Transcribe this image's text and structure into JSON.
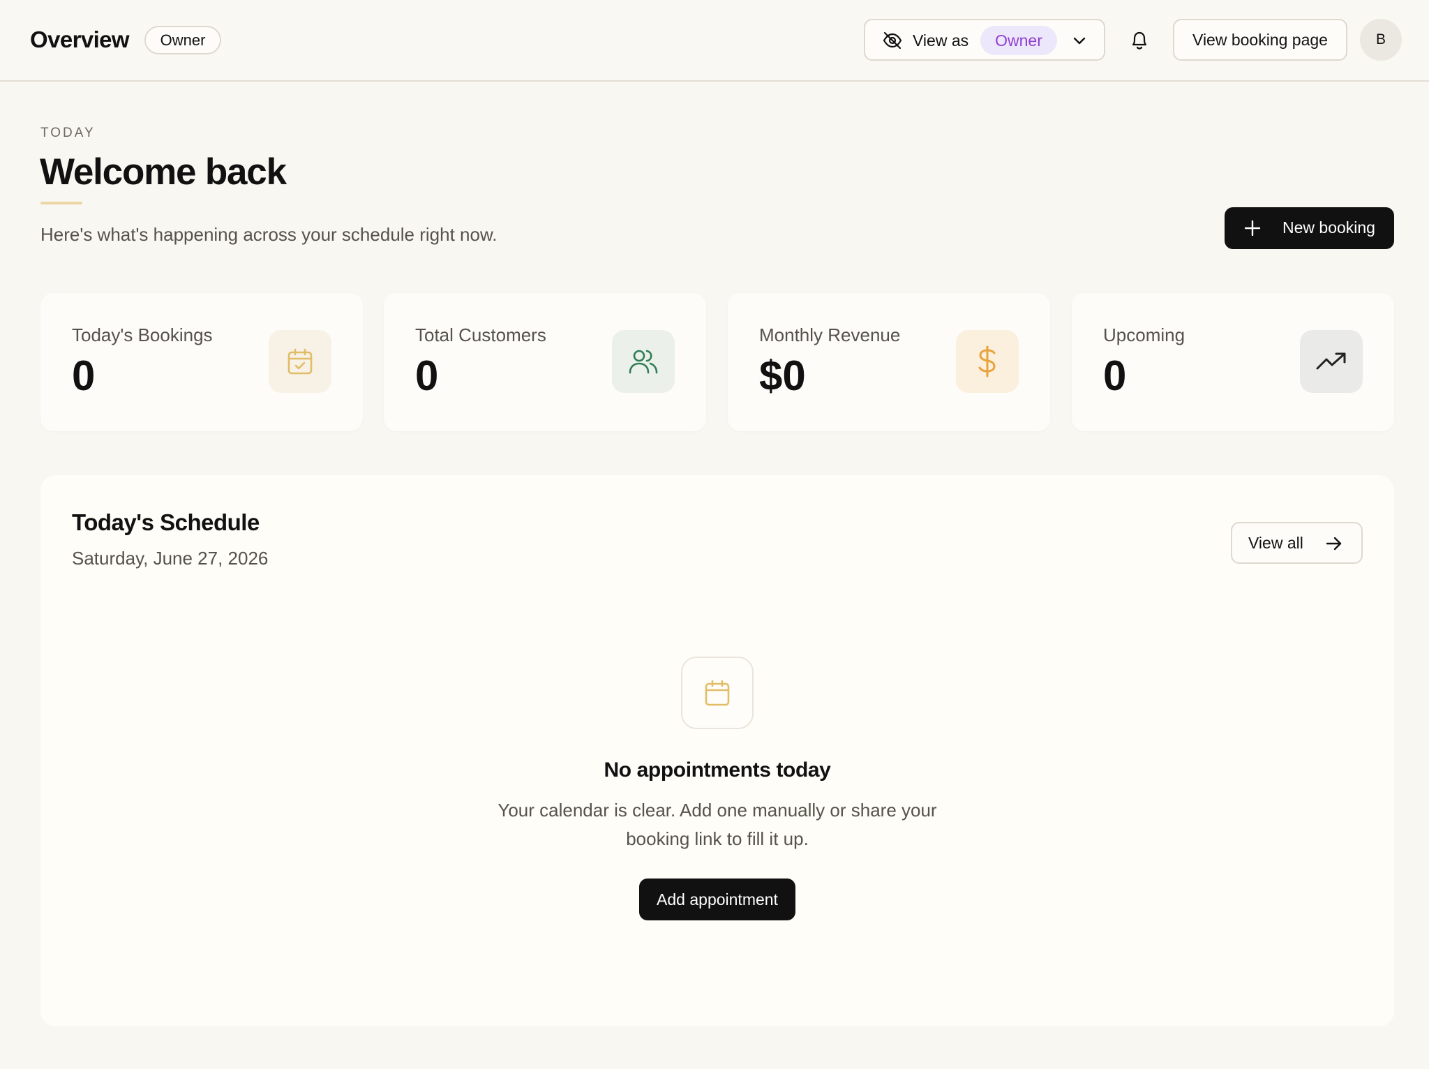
{
  "header": {
    "title": "Overview",
    "role_badge": "Owner",
    "view_as_label": "View as",
    "view_as_role": "Owner",
    "view_booking_page": "View booking page",
    "avatar_initial": "B"
  },
  "intro": {
    "eyebrow": "TODAY",
    "heading": "Welcome back",
    "subtitle": "Here's what's happening across your schedule right now.",
    "new_booking": "New booking"
  },
  "stats": [
    {
      "label": "Today's Bookings",
      "value": "0",
      "icon": "calendar-check-icon",
      "icon_color": "#e2bd68",
      "icon_bg": "#f7f1e6"
    },
    {
      "label": "Total Customers",
      "value": "0",
      "icon": "users-icon",
      "icon_color": "#2f7d55",
      "icon_bg": "#ecf0ea"
    },
    {
      "label": "Monthly Revenue",
      "value": "$0",
      "icon": "dollar-icon",
      "icon_color": "#e9a23c",
      "icon_bg": "#fbf0de"
    },
    {
      "label": "Upcoming",
      "value": "0",
      "icon": "trending-up-icon",
      "icon_color": "#222222",
      "icon_bg": "#eaeae8"
    }
  ],
  "schedule": {
    "title": "Today's Schedule",
    "date": "Saturday, June 27, 2026",
    "view_all": "View all",
    "empty_title": "No appointments today",
    "empty_desc": "Your calendar is clear. Add one manually or share your booking link to fill it up.",
    "add_button": "Add appointment"
  },
  "colors": {
    "background": "#f9f7f2",
    "primary_button": "#111111",
    "view_as_badge_bg": "#ede7fb",
    "view_as_badge_text": "#8f3fd1",
    "accent": "#ecd6a5"
  }
}
